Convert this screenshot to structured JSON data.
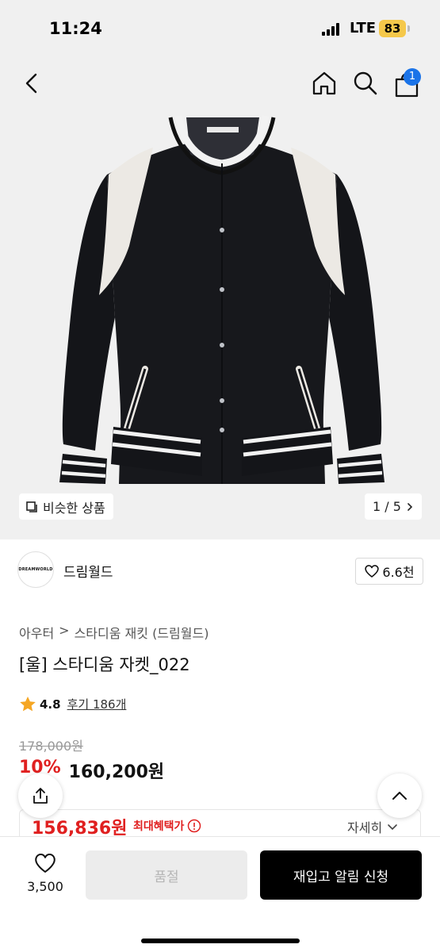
{
  "status_bar": {
    "time": "11:24",
    "network": "LTE",
    "battery": "83"
  },
  "header": {
    "cart_count": "1"
  },
  "gallery": {
    "similar_label": "비슷한 상품",
    "page_indicator": "1 / 5",
    "logo_text": "DREAMWORLD"
  },
  "brand": {
    "name": "드림월드",
    "logo_text": "DREAMWORLD",
    "likes": "6.6천"
  },
  "breadcrumb": {
    "category": "아우터",
    "separator": ">",
    "subcategory": "스타디움 재킷 (드림월드)"
  },
  "product": {
    "title": "[울] 스타디움 자켓_022"
  },
  "rating": {
    "score": "4.8",
    "reviews": "후기 186개"
  },
  "price": {
    "original": "178,000원",
    "discount": "10%",
    "sale": "160,200원",
    "max_benefit_price": "156,836원",
    "max_benefit_label": "최대혜택가",
    "detail_label": "자세히"
  },
  "bottom_bar": {
    "wish_count": "3,500",
    "soldout_label": "품절",
    "notify_label": "재입고 알림 신청"
  },
  "colors": {
    "accent_red": "#e02020",
    "badge_blue": "#1a73e8",
    "battery_yellow": "#f5c84a"
  },
  "icons": [
    "back-icon",
    "home-icon",
    "search-icon",
    "cart-icon",
    "similar-icon",
    "chevron-right-icon",
    "heart-icon",
    "star-icon",
    "info-icon",
    "chevron-down-icon",
    "share-icon",
    "chevron-up-icon"
  ]
}
